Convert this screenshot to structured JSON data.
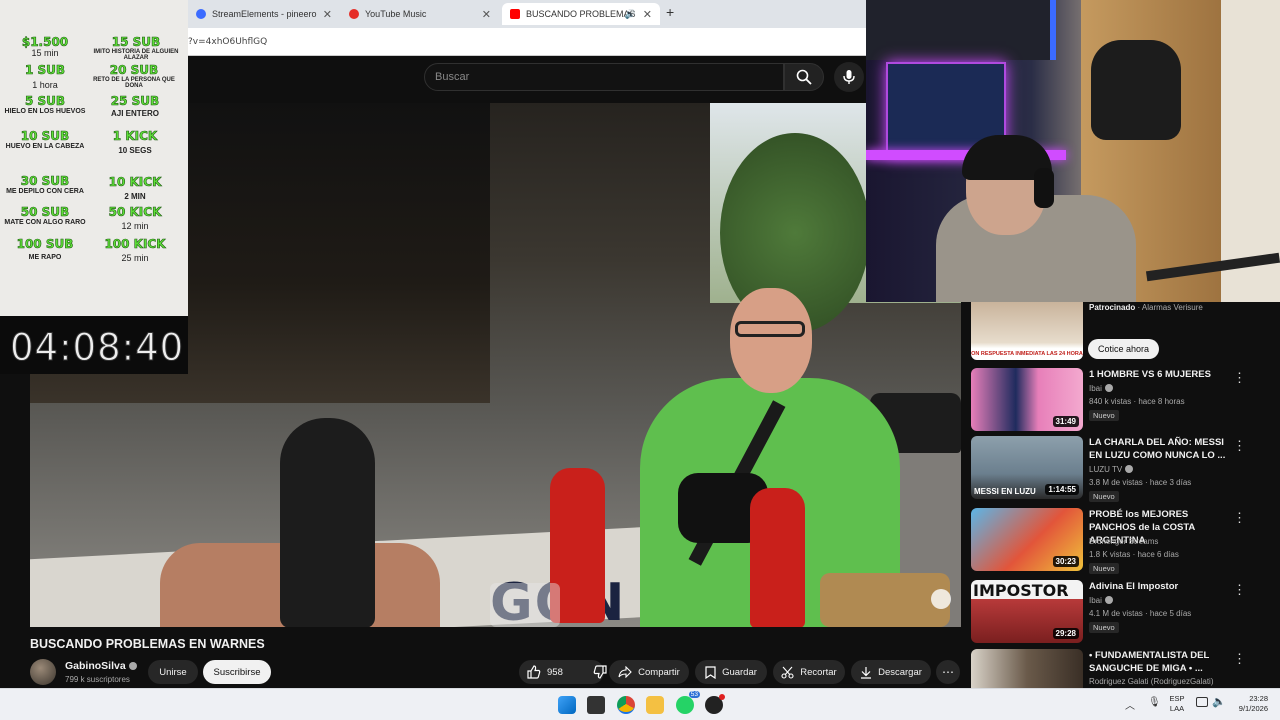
{
  "browser": {
    "tabs": [
      {
        "label": "StreamElements - pineero",
        "favicon_color": "#3b6bff"
      },
      {
        "label": "YouTube Music",
        "favicon_color": "#e52d27"
      },
      {
        "label": "BUSCANDO PROBLEMAS E",
        "favicon_color": "#ff0000"
      }
    ],
    "new_tab_label": "+",
    "address": "?v=4xhO6UhflGQ"
  },
  "youtube": {
    "search_placeholder": "Buscar",
    "video_title": "BUSCANDO PROBLEMAS EN WARNES",
    "video_overlay_text": "GON",
    "channel": {
      "name": "GabinoSilva",
      "subscribers": "799 k suscriptores"
    },
    "join_label": "Unirse",
    "subscribe_label": "Suscribirse",
    "like_count": "958",
    "share_label": "Compartir",
    "save_label": "Guardar",
    "clip_label": "Recortar",
    "download_label": "Descargar"
  },
  "overlay": {
    "rewards": [
      {
        "goal": "$1.500",
        "desc": "15 min"
      },
      {
        "goal": "15 SUB",
        "desc": "IMITO HISTORIA DE ALGUIEN ALAZAR"
      },
      {
        "goal": "1 SUB",
        "desc": "1 hora"
      },
      {
        "goal": "20 SUB",
        "desc": "RETO DE LA PERSONA QUE DONA"
      },
      {
        "goal": "5 SUB",
        "desc": "HIELO EN LOS HUEVOS"
      },
      {
        "goal": "25 SUB",
        "desc": "AJI ENTERO"
      },
      {
        "goal": "10 SUB",
        "desc": "HUEVO EN LA CABEZA"
      },
      {
        "goal": "1 KICK",
        "desc": "10 SEGS"
      },
      {
        "goal": "30 SUB",
        "desc": "ME DEPILO CON CERA"
      },
      {
        "goal": "10 KICK",
        "desc": "2 MIN"
      },
      {
        "goal": "50 SUB",
        "desc": "MATE CON ALGO RARO"
      },
      {
        "goal": "50 KICK",
        "desc": "12 min"
      },
      {
        "goal": "100 SUB",
        "desc": "ME RAPO"
      },
      {
        "goal": "100 KICK",
        "desc": "25 min"
      }
    ],
    "timer": "04:08:40"
  },
  "sidebar": {
    "ad": {
      "sponsored": "Patrocinado",
      "advertiser": "Alarmas Verisure",
      "cta": "Cotice ahora",
      "banner_text": "ON RESPUESTA INMEDIATA LAS 24 HORA"
    },
    "videos": [
      {
        "title": "1 HOMBRE VS 6 MUJERES",
        "channel": "Ibai",
        "meta": "840 k vistas · hace 8 horas",
        "badge": "Nuevo",
        "duration": "31:49",
        "thumb": "#d96aa8"
      },
      {
        "title": "LA CHARLA DEL AÑO: MESSI EN LUZU COMO NUNCA LO ...",
        "channel": "LUZU TV",
        "meta": "3.8 M de vistas · hace 3 días",
        "badge": "Nuevo",
        "duration": "1:14:55",
        "thumb_text": "MESSI EN LUZU",
        "thumb": "#6b7f8e"
      },
      {
        "title": "PROBÉ los MEJORES PANCHOS de la COSTA ARGENTINA",
        "channel": "Brunenger Streams",
        "meta": "1.8 K vistas · hace 6 días",
        "badge": "Nuevo",
        "duration": "30:23",
        "thumb": "#e2553a"
      },
      {
        "title": "Adivina El Impostor",
        "channel": "Ibai",
        "meta": "4.1 M de vistas · hace 5 días",
        "badge": "Nuevo",
        "duration": "29:28",
        "thumb_text": "IMPOSTOR",
        "thumb": "#b83a3a"
      },
      {
        "title": "• FUNDAMENTALISTA DEL SANGUCHE DE MIGA • ...",
        "channel": "Rodriguez Galati (RodriguezGalati)",
        "meta": "",
        "badge": "",
        "duration": "",
        "thumb": "#6a5a4a"
      }
    ]
  },
  "taskbar": {
    "lang_top": "ESP",
    "lang_bottom": "LAA",
    "time": "23:28",
    "date": "9/1/2026",
    "whatsapp_badge": "53"
  }
}
